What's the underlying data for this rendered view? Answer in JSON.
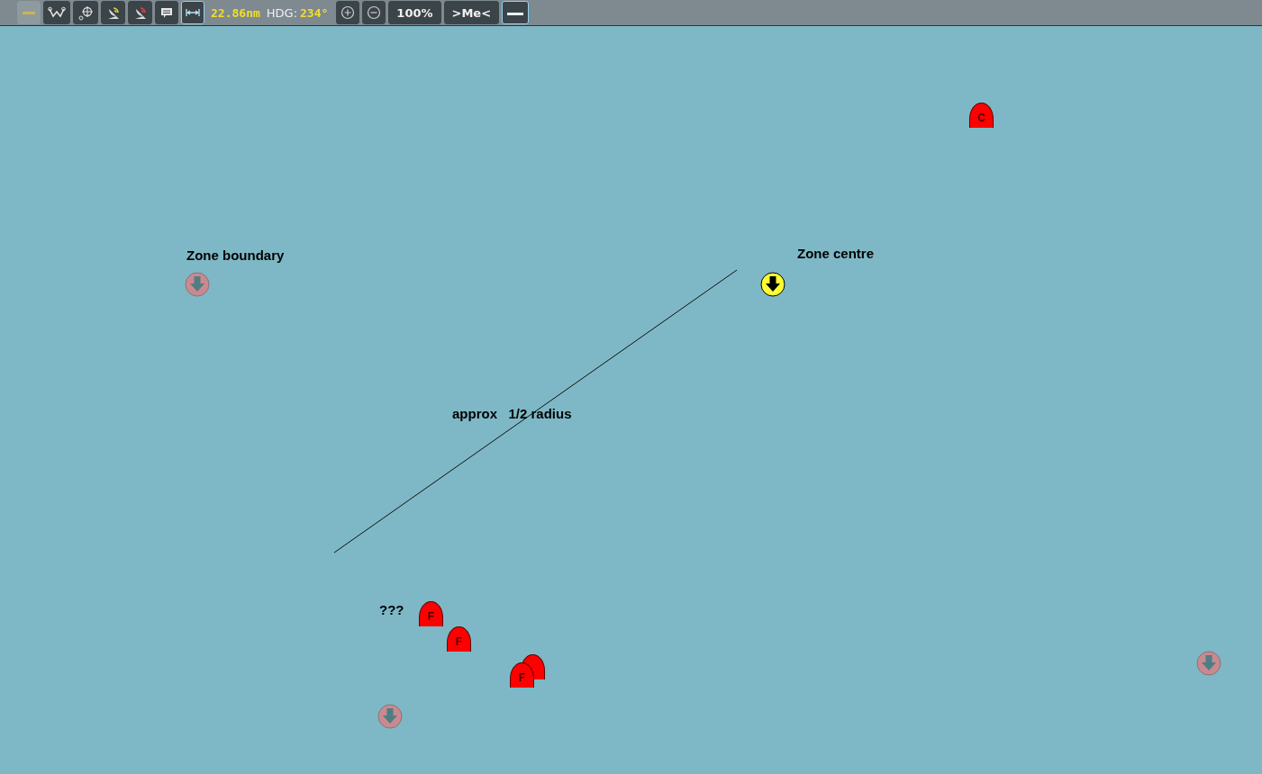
{
  "toolbar": {
    "tools": [
      {
        "kind": "dash",
        "selected": false,
        "disabled": true
      },
      {
        "kind": "route",
        "selected": false,
        "disabled": false
      },
      {
        "kind": "target",
        "selected": false,
        "disabled": false
      },
      {
        "kind": "radar-yellow",
        "selected": false,
        "disabled": false
      },
      {
        "kind": "radar-red",
        "selected": false,
        "disabled": false
      },
      {
        "kind": "message",
        "selected": false,
        "disabled": false
      },
      {
        "kind": "measure",
        "selected": true,
        "disabled": false
      }
    ],
    "distance": "22.86nm",
    "heading_label": "HDG:",
    "heading": "234°",
    "zoom_buttons": [
      {
        "kind": "plus"
      },
      {
        "kind": "minus"
      }
    ],
    "zoom": "100%",
    "center_me": ">Me<",
    "end_tool": {
      "kind": "line",
      "selected": true
    }
  },
  "map": {
    "labels": [
      {
        "text": "Zone boundary"
      },
      {
        "text": "Zone centre"
      },
      {
        "text": "approx   1/2 radius"
      },
      {
        "text": "???"
      }
    ],
    "waypoints": [
      {
        "kind": "boundary"
      },
      {
        "kind": "centre"
      },
      {
        "kind": "boundary"
      },
      {
        "kind": "boundary"
      }
    ],
    "contacts": [
      {
        "kind": "dome",
        "letter": "C"
      },
      {
        "kind": "dome",
        "letter": "F"
      },
      {
        "kind": "dome",
        "letter": "F"
      },
      {
        "kind": "dome"
      },
      {
        "kind": "dome",
        "letter": "F"
      }
    ]
  }
}
